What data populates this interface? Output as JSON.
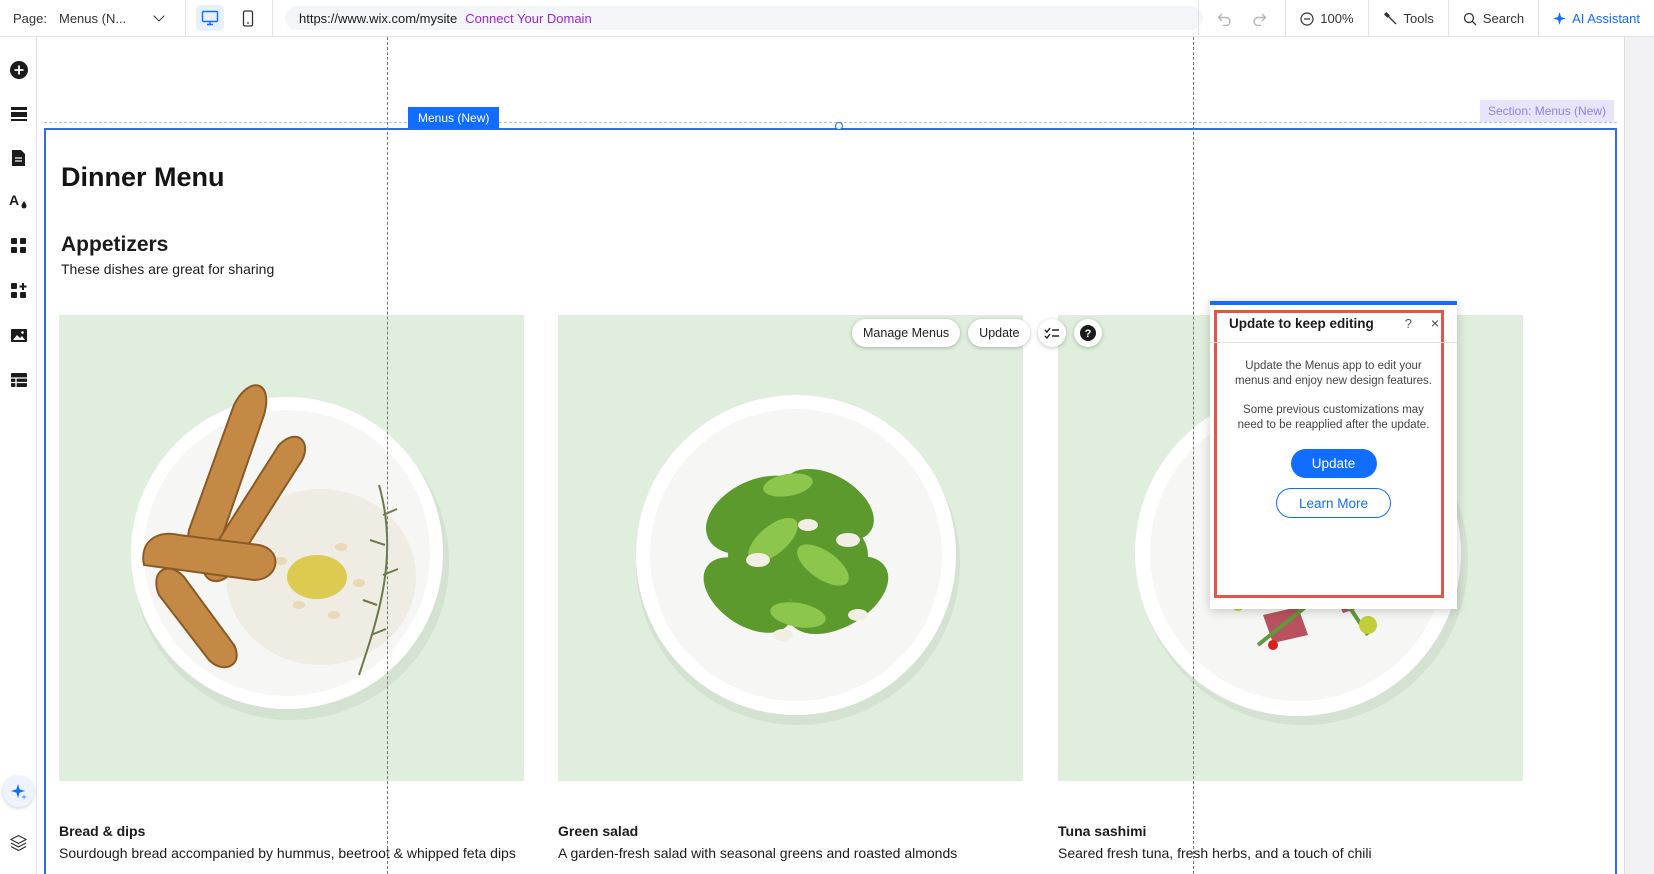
{
  "topbar": {
    "page_label": "Page:",
    "page_value": "Menus (N...",
    "url": "https://www.wix.com/mysite",
    "connect_domain": "Connect Your Domain",
    "zoom": "100%",
    "tools": "Tools",
    "search": "Search",
    "ai_assistant": "AI Assistant"
  },
  "sidebar": {
    "icons": [
      "add-icon",
      "sections-icon",
      "pages-icon",
      "design-icon",
      "apps-icon",
      "business-apps-icon",
      "media-icon",
      "cms-icon",
      "ai-sparkle-icon",
      "layers-icon"
    ]
  },
  "canvas": {
    "component_tag": "Menus (New)",
    "section_tag": "Section: Menus (New)",
    "menu_title": "Dinner Menu",
    "section_title": "Appetizers",
    "section_description": "These dishes are great for sharing",
    "floating_tools": {
      "manage_menus": "Manage Menus",
      "update": "Update"
    },
    "items": [
      {
        "name": "Bread & dips",
        "description": "Sourdough bread accompanied by hummus, beetroot & whipped feta dips"
      },
      {
        "name": "Green salad",
        "description": "A garden-fresh salad with seasonal greens and roasted almonds"
      },
      {
        "name": "Tuna sashimi",
        "description": "Seared fresh tuna, fresh herbs, and a touch of chili"
      }
    ]
  },
  "update_panel": {
    "title": "Update to keep editing",
    "help": "?",
    "close": "×",
    "body_1": "Update the Menus app to edit your menus and enjoy new design features.",
    "body_2": "Some previous customizations may need to be reapplied after the update.",
    "primary_button": "Update",
    "secondary_button": "Learn More"
  },
  "colors": {
    "accent": "#116dff",
    "connect": "#9a27d5",
    "card_bg": "#dfeedd",
    "highlight": "#e0574a"
  }
}
